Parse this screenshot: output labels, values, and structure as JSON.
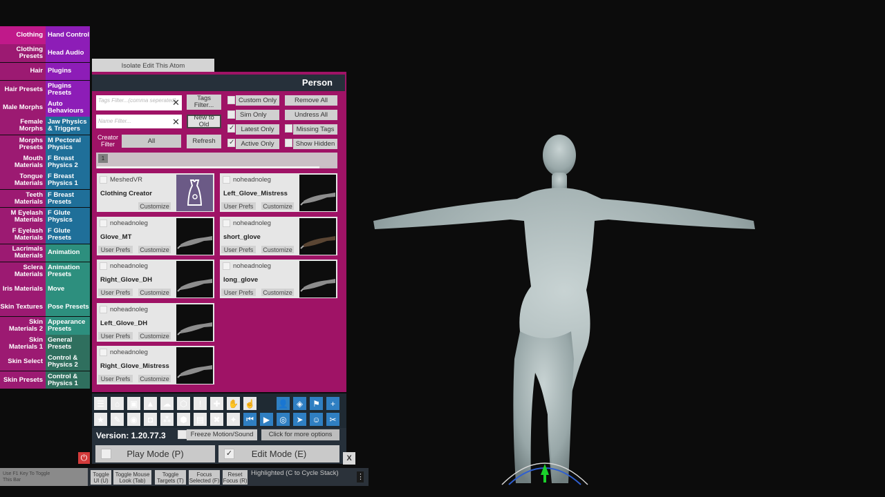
{
  "left_tabs_col1": [
    "Clothing",
    "Clothing Presets",
    "Hair",
    "Hair Presets",
    "Male Morphs",
    "Female Morphs",
    "Morphs Presets",
    "Mouth Materials",
    "Tongue Materials",
    "Teeth Materials",
    "M Eyelash Materials",
    "F Eyelash Materials",
    "Lacrimals Materials",
    "Sclera Materials",
    "Iris Materials",
    "Skin Textures",
    "Skin Materials 2",
    "Skin Materials 1",
    "Skin Select",
    "Skin Presets"
  ],
  "left_tabs_col2": [
    "Hand Control",
    "Head Audio",
    "Plugins",
    "Plugins Presets",
    "Auto Behaviours",
    "Jaw Physics & Triggers",
    "M Pectoral Physics",
    "F Breast Physics 2",
    "F Breast Physics 1",
    "F Breast Presets",
    "F Glute Physics",
    "F Glute Presets",
    "Animation",
    "Animation Presets",
    "Move",
    "Pose Presets",
    "Appearance Presets",
    "General Presets",
    "Control & Physics 2",
    "Control & Physics 1"
  ],
  "isolate_button": "Isolate Edit This Atom",
  "panel_title": "Person",
  "filters": {
    "tags_placeholder": "Tags Filter...(comma seperated)",
    "name_placeholder": "Name Filter...",
    "clear_icon": "✕",
    "tags_button": "Tags Filter...",
    "sort_button": "New to Old",
    "refresh_button": "Refresh",
    "creator_label": "Creator Filter",
    "creator_value": "All",
    "custom_only": "Custom Only",
    "sim_only": "Sim Only",
    "latest_only": "Latest Only",
    "active_only": "Active Only",
    "remove_all": "Remove All",
    "undress_all": "Undress All",
    "missing_tags": "Missing Tags",
    "show_hidden": "Show Hidden",
    "check": "✓",
    "page": "1"
  },
  "items": [
    {
      "creator": "MeshedVR",
      "name": "Clothing Creator",
      "buttons": [
        "Customize"
      ]
    },
    {
      "creator": "noheadnoleg",
      "name": "Left_Glove_Mistress",
      "buttons": [
        "User Prefs",
        "Customize"
      ]
    },
    {
      "creator": "noheadnoleg",
      "name": "Glove_MT",
      "buttons": [
        "User Prefs",
        "Customize"
      ]
    },
    {
      "creator": "noheadnoleg",
      "name": "short_glove",
      "buttons": [
        "User Prefs",
        "Customize"
      ]
    },
    {
      "creator": "noheadnoleg",
      "name": "Right_Glove_DH",
      "buttons": [
        "User Prefs",
        "Customize"
      ]
    },
    {
      "creator": "noheadnoleg",
      "name": "long_glove",
      "buttons": [
        "User Prefs",
        "Customize"
      ]
    },
    {
      "creator": "noheadnoleg",
      "name": "Left_Glove_DH",
      "buttons": [
        "User Prefs",
        "Customize"
      ]
    },
    {
      "creator": "noheadnoleg",
      "name": "Right_Glove_Mistress",
      "buttons": [
        "User Prefs",
        "Customize"
      ]
    }
  ],
  "version": "Version: 1.20.77.3",
  "freeze_label": "Freeze Motion/Sound",
  "more_options": "Click for more options",
  "play_mode": "Play Mode (P)",
  "edit_mode": "Edit Mode (E)",
  "close_x": "X",
  "power_icon": "⏻",
  "f1_hint": "Use F1 Key To Toggle This Bar",
  "bottom_buttons": [
    "Toggle UI (U)",
    "Toggle Mouse Look (Tab)",
    "Toggle Targets (T)",
    "Focus Selected (F)",
    "Reset Focus (R)"
  ],
  "highlighted": "Highlighted (C to Cycle Stack)",
  "menu_dots": "⋮",
  "toolbar_icons_row1": [
    "menu-icon",
    "scene-open-icon",
    "folder-icon",
    "save-icon",
    "cloud-icon",
    "package-icon",
    "alert-icon",
    "person-add-icon",
    "hand-icon",
    "grab-icon",
    "person-icon",
    "unity-icon",
    "flag-icon",
    "plus-icon"
  ],
  "toolbar_icons_row2": [
    "star-icon",
    "edit-scene-icon",
    "screenshot-icon",
    "camera-icon",
    "network-icon",
    "box-icon",
    "document-icon",
    "person-remove-icon",
    "wand-icon",
    "skip-back-icon",
    "play-icon",
    "target-icon",
    "pointer-icon",
    "group-icon",
    "tools-icon"
  ],
  "toolbar_glyphs_row1": [
    "☰",
    "⌂",
    "▣",
    "▲",
    "☁",
    "⬡",
    "!",
    "✚",
    "✋",
    "☝",
    "👤",
    "◈",
    "⚑",
    "+"
  ],
  "toolbar_glyphs_row2": [
    "★",
    "✎",
    "◉",
    "◘",
    "⁂",
    "⬢",
    "▤",
    "✖",
    "✦",
    "⏮",
    "▶",
    "◎",
    "➤",
    "☺",
    "✂"
  ]
}
